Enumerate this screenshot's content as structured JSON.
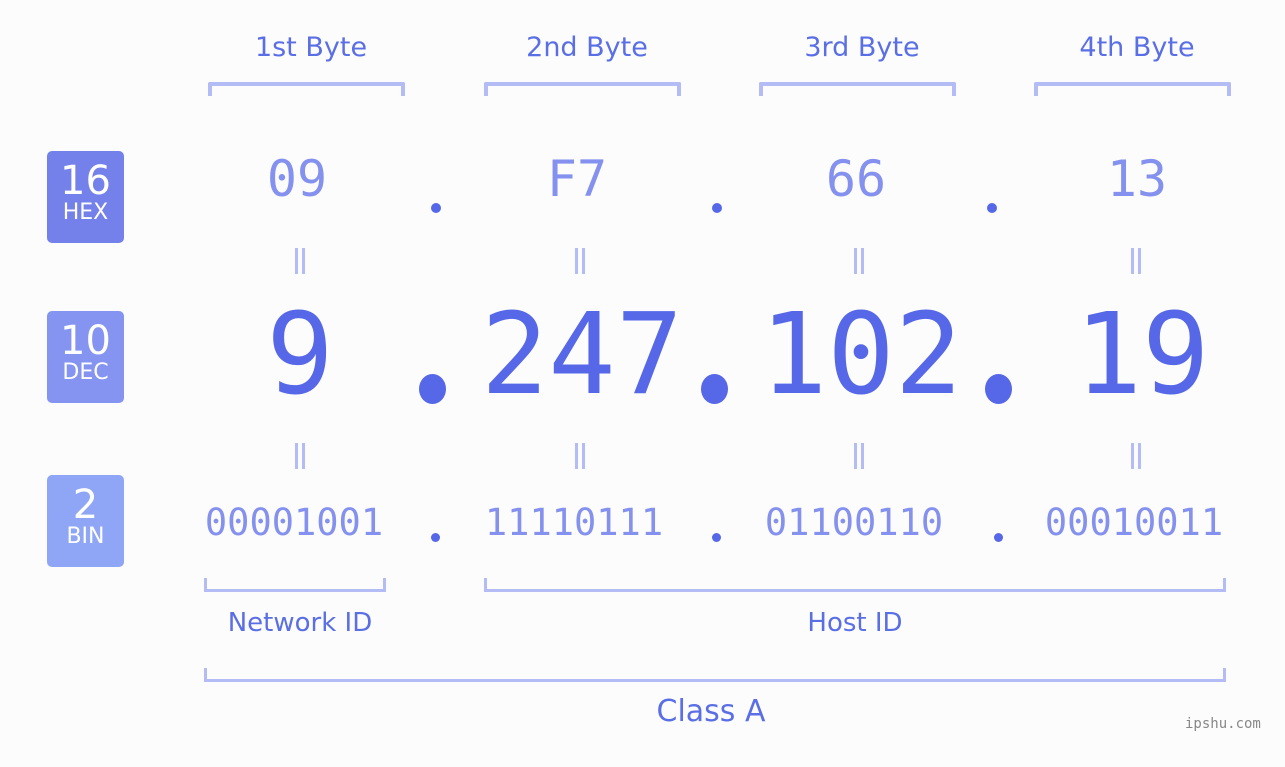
{
  "bytes": {
    "labels": [
      "1st Byte",
      "2nd Byte",
      "3rd Byte",
      "4th Byte"
    ]
  },
  "badges": {
    "hex": {
      "base": "16",
      "name": "HEX",
      "color": "#7581ea"
    },
    "dec": {
      "base": "10",
      "name": "DEC",
      "color": "#8494f0"
    },
    "bin": {
      "base": "2",
      "name": "BIN",
      "color": "#8fa6f6"
    }
  },
  "hex": [
    "09",
    "F7",
    "66",
    "13"
  ],
  "dec": [
    "9",
    "247",
    "102",
    "19"
  ],
  "bin": [
    "00001001",
    "11110111",
    "01100110",
    "00010011"
  ],
  "separator": ".",
  "equals": "=",
  "sections": {
    "network_id": "Network ID",
    "host_id": "Host ID",
    "class": "Class A"
  },
  "watermark": "ipshu.com",
  "colors": {
    "accent": "#5668e8",
    "light_accent": "#8591ee",
    "bracket": "#b3bcf5"
  }
}
